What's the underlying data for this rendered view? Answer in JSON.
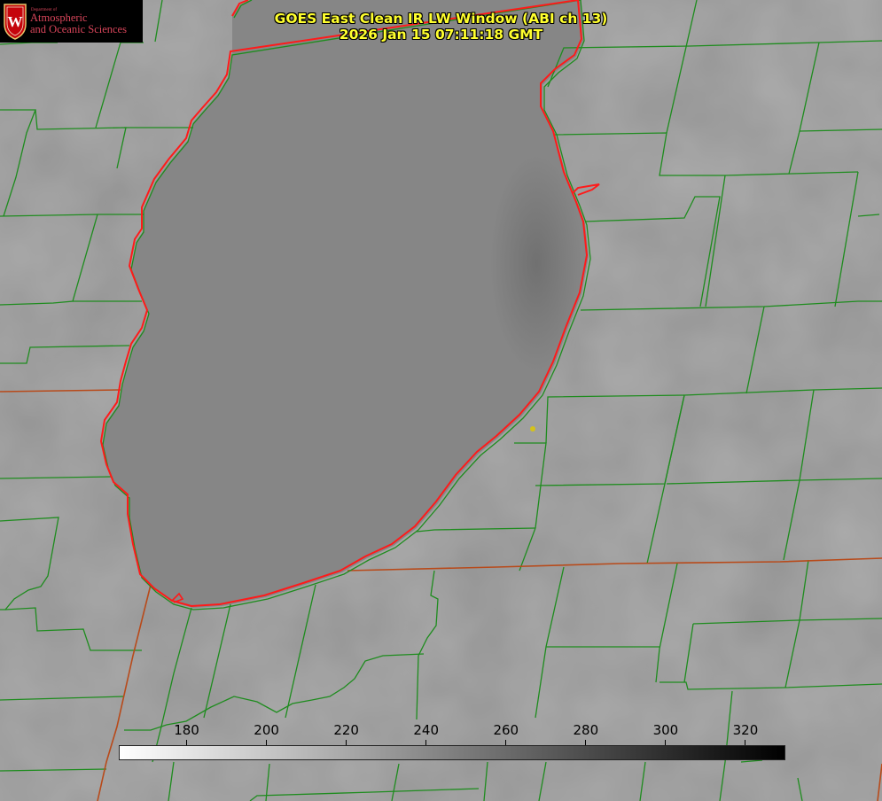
{
  "logo": {
    "dept_label": "Department of",
    "line1": "Atmospheric",
    "line2": "and Oceanic Sciences",
    "seal_letter": "W",
    "seal_icon": "uw-crest-icon"
  },
  "title": {
    "line1": "GOES East Clean IR LW Window (ABI ch 13)",
    "line2": "2026 Jan 15 07:11:18 GMT"
  },
  "colorbar": {
    "ticks": [
      "180",
      "200",
      "220",
      "240",
      "260",
      "280",
      "300",
      "320"
    ],
    "min_value": 163,
    "max_value": 330,
    "gradient_start": "#ffffff",
    "gradient_end": "#000000"
  },
  "colors": {
    "county_lines": "#1e8c1e",
    "state_lines": "#b84a1a",
    "lake_outline": "#ff1a1a",
    "title_text": "#ffff2e",
    "logo_text": "#d8455a",
    "site_marker": "#d4c21a"
  }
}
